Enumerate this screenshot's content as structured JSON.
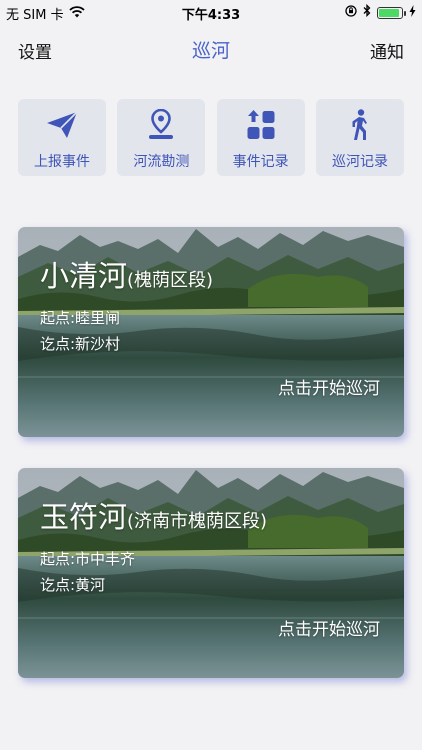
{
  "status_bar": {
    "carrier": "无 SIM 卡",
    "time": "下午4:33",
    "battery_level": 0.92,
    "icons": [
      "wifi-icon",
      "rotation-lock-icon",
      "bluetooth-icon",
      "battery-icon",
      "charging-icon"
    ]
  },
  "nav": {
    "left": "设置",
    "title": "巡河",
    "right": "通知"
  },
  "actions": [
    {
      "label": "上报事件",
      "icon": "paper-plane-icon"
    },
    {
      "label": "河流勘测",
      "icon": "location-pin-icon"
    },
    {
      "label": "事件记录",
      "icon": "apps-grid-icon"
    },
    {
      "label": "巡河记录",
      "icon": "walking-person-icon"
    }
  ],
  "rivers": [
    {
      "name": "小清河",
      "section": "(槐荫区段)",
      "start": "起点:睦里闸",
      "end": "讫点:新沙村",
      "action": "点击开始巡河"
    },
    {
      "name": "玉符河",
      "section": "(济南市槐荫区段)",
      "start": "起点:市中丰齐",
      "end": "讫点:黄河",
      "action": "点击开始巡河"
    }
  ],
  "colors": {
    "accent": "#4a63c8",
    "tile_bg": "#e3e5ec",
    "tile_icon": "#4055b8",
    "page_bg": "#f2f2f4"
  }
}
